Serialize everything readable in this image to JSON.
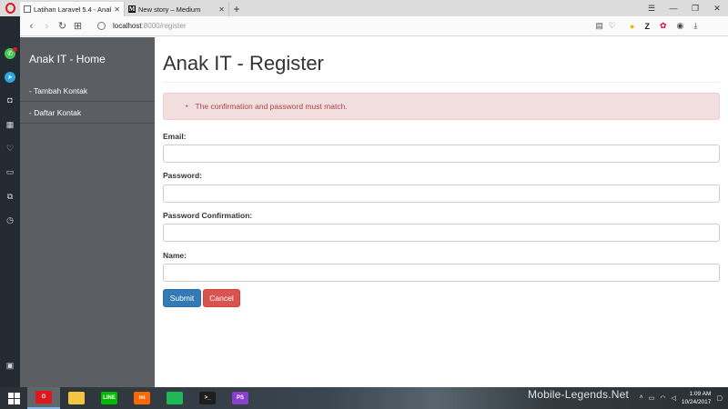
{
  "browser": {
    "tabs": [
      {
        "title": "Latihan Laravel 5.4 - Anak",
        "icon": "document-icon",
        "active": true
      },
      {
        "title": "New story – Medium",
        "icon": "medium-icon",
        "active": false
      }
    ],
    "new_tab_label": "+",
    "url_host": "localhost",
    "url_path": ":8000/register"
  },
  "sidebar": {
    "brand": "Anak IT - Home",
    "items": [
      {
        "label": "- Tambah Kontak"
      },
      {
        "label": "- Daftar Kontak"
      }
    ]
  },
  "main": {
    "title": "Anak IT - Register",
    "alert": {
      "bullet": "•",
      "message": "The confirmation and password must match."
    },
    "fields": [
      {
        "label": "Email:",
        "value": ""
      },
      {
        "label": "Password:",
        "value": ""
      },
      {
        "label": "Password Confirmation:",
        "value": ""
      },
      {
        "label": "Name:",
        "value": ""
      }
    ],
    "buttons": {
      "submit": "Submit",
      "cancel": "Cancel"
    }
  },
  "taskbar": {
    "apps": [
      {
        "name": "opera",
        "icon": "opera-icon",
        "color": "#e0161d",
        "glyph": "O",
        "active": true
      },
      {
        "name": "file-explorer",
        "icon": "folder-icon",
        "color": "#f4c542",
        "glyph": "",
        "active": false
      },
      {
        "name": "line",
        "icon": "line-icon",
        "color": "#00b900",
        "glyph": "LINE",
        "active": false
      },
      {
        "name": "mi",
        "icon": "mi-icon",
        "color": "#ff6700",
        "glyph": "mi",
        "active": false
      },
      {
        "name": "spotify",
        "icon": "spotify-icon",
        "color": "#1db954",
        "glyph": "",
        "active": false
      },
      {
        "name": "terminal",
        "icon": "terminal-icon",
        "color": "#1e1e1e",
        "glyph": ">_",
        "active": false
      },
      {
        "name": "phpstorm",
        "icon": "phpstorm-icon",
        "color": "#8a3fd1",
        "glyph": "PS",
        "active": false
      }
    ],
    "watermark": "Mobile-Legends.Net",
    "time": "1:09 AM",
    "date": "10/24/2017"
  },
  "colors": {
    "primary": "#337ab7",
    "danger": "#d9534f",
    "alert_bg": "#f2dede",
    "alert_text": "#a94442",
    "sidebar_bg": "#5b5e63"
  }
}
